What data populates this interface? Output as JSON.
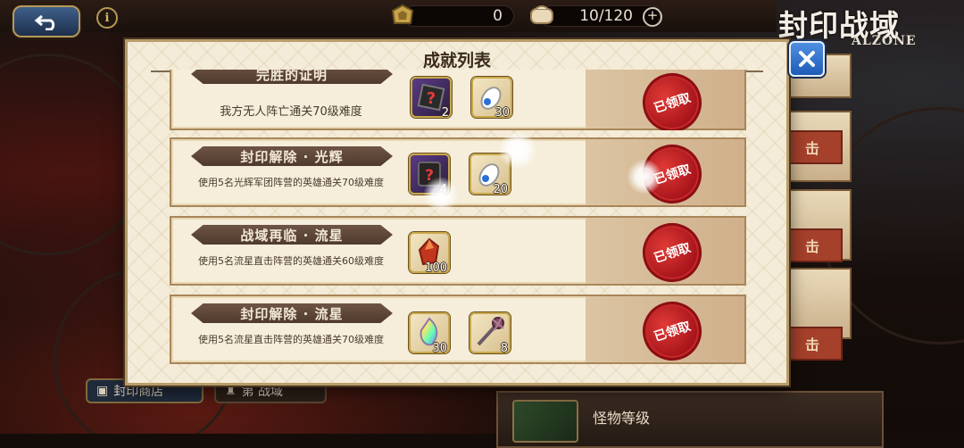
{
  "topbar": {
    "currency1": "0",
    "stamina": "10/120"
  },
  "logo": {
    "title": "封印战域",
    "subtitle": "ALZONE"
  },
  "dialog": {
    "title": "成就列表",
    "rows": [
      {
        "title": "完胜的证明",
        "desc": "我方无人阵亡通关70级难度",
        "items": [
          {
            "icon": "mystery-box-icon",
            "count": "2"
          },
          {
            "icon": "potion-icon",
            "count": "30"
          }
        ],
        "status": "已领取"
      },
      {
        "title": "封印解除 · 光辉",
        "desc": "使用5名光辉军团阵营的英雄通关70级难度",
        "items": [
          {
            "icon": "mystery-scroll-icon",
            "count": "4"
          },
          {
            "icon": "potion-icon",
            "count": "20"
          }
        ],
        "status": "已领取"
      },
      {
        "title": "战域再临 · 流星",
        "desc": "使用5名流星直击阵营的英雄通关60级难度",
        "items": [
          {
            "icon": "red-crystal-icon",
            "count": "100"
          }
        ],
        "status": "已领取"
      },
      {
        "title": "封印解除 · 流星",
        "desc": "使用5名流星直击阵营的英雄通关70级难度",
        "items": [
          {
            "icon": "rainbow-crystal-icon",
            "count": "30"
          },
          {
            "icon": "staff-icon",
            "count": "8"
          }
        ],
        "status": "已领取"
      }
    ]
  },
  "side": {
    "labels": [
      "击",
      "击",
      "击",
      "击"
    ]
  },
  "bottom": {
    "shop_label": "封印商店",
    "zone_label": "第   战域",
    "monster_label": "怪物等级"
  },
  "colors": {
    "accent_blue": "#1f5cb8",
    "stamp_red": "#a7141a",
    "panel_bg": "#f4ecd8"
  }
}
